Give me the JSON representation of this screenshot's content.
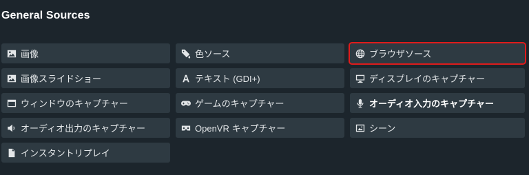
{
  "section": {
    "title": "General Sources"
  },
  "sources": [
    {
      "id": "image",
      "icon": "image-icon",
      "label": "画像"
    },
    {
      "id": "color-source",
      "icon": "paint-bucket-icon",
      "label": "色ソース"
    },
    {
      "id": "browser-source",
      "icon": "globe-icon",
      "label": "ブラウザソース",
      "highlighted": true
    },
    {
      "id": "image-slideshow",
      "icon": "image-icon",
      "label": "画像スライドショー"
    },
    {
      "id": "text-gdi",
      "icon": "text-icon",
      "label": "テキスト (GDI+)"
    },
    {
      "id": "display-capture",
      "icon": "monitor-icon",
      "label": "ディスプレイのキャプチャー"
    },
    {
      "id": "window-capture",
      "icon": "window-icon",
      "label": "ウィンドウのキャプチャー"
    },
    {
      "id": "game-capture",
      "icon": "gamepad-icon",
      "label": "ゲームのキャプチャー"
    },
    {
      "id": "audio-input-capture",
      "icon": "microphone-icon",
      "label": "オーディオ入力のキャプチャー",
      "bold": true
    },
    {
      "id": "audio-output-capture",
      "icon": "speaker-icon",
      "label": "オーディオ出力のキャプチャー"
    },
    {
      "id": "openvr-capture",
      "icon": "vr-headset-icon",
      "label": "OpenVR キャプチャー"
    },
    {
      "id": "scene",
      "icon": "scene-icon",
      "label": "シーン"
    },
    {
      "id": "instant-replay",
      "icon": "file-icon",
      "label": "インスタントリプレイ"
    }
  ],
  "colors": {
    "background": "#1c252c",
    "button": "#2e3a42",
    "highlight": "#e01b1b"
  }
}
